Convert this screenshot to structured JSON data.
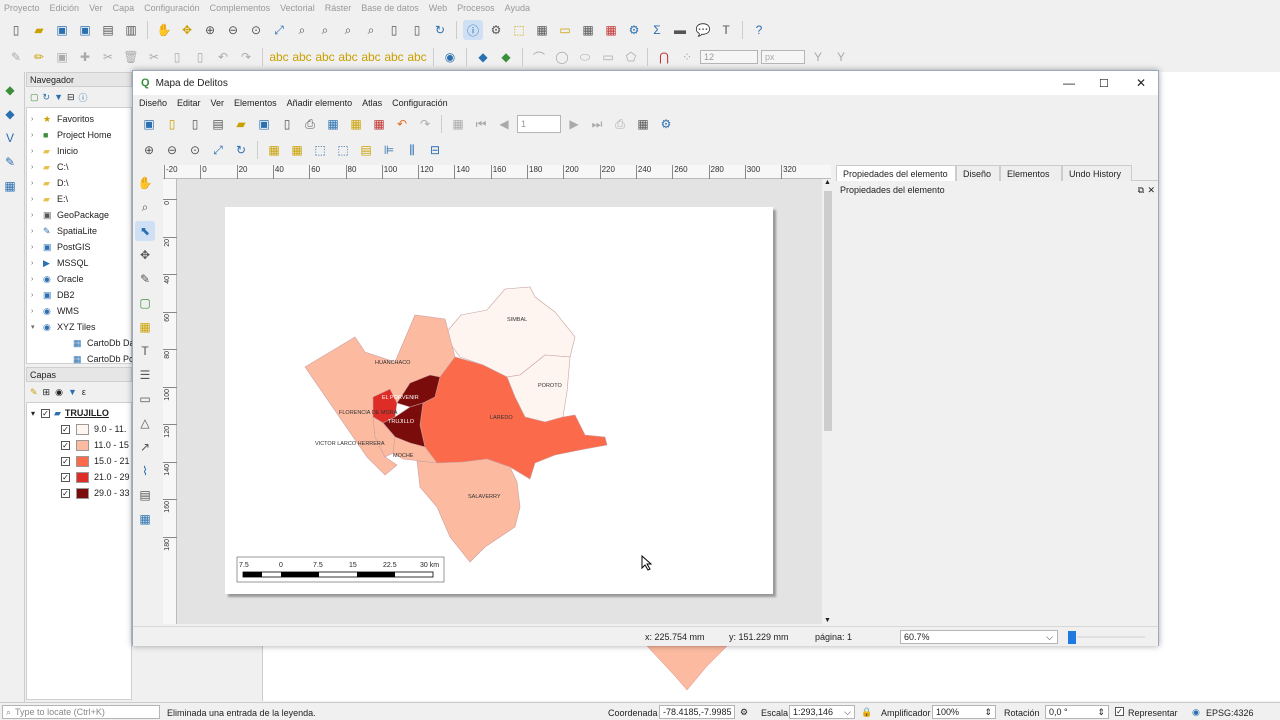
{
  "main_menu": [
    "Proyecto",
    "Edición",
    "Ver",
    "Capa",
    "Configuración",
    "Complementos",
    "Vectorial",
    "Ráster",
    "Base de datos",
    "Web",
    "Procesos",
    "Ayuda"
  ],
  "navigator": {
    "title": "Navegador",
    "items": [
      "Favoritos",
      "Project Home",
      "Inicio",
      "C:\\",
      "D:\\",
      "E:\\",
      "GeoPackage",
      "SpatiaLite",
      "PostGIS",
      "MSSQL",
      "Oracle",
      "DB2",
      "WMS",
      "XYZ Tiles",
      "CartoDb Dark",
      "CartoDb Posit"
    ]
  },
  "layers": {
    "title": "Capas",
    "group": "TRUJILLO",
    "classes": [
      {
        "label": "9.0 - 11.",
        "color": "#fff5f0"
      },
      {
        "label": "11.0 - 15",
        "color": "#fcbba1"
      },
      {
        "label": "15.0 - 21",
        "color": "#fb6a4a"
      },
      {
        "label": "21.0 - 29",
        "color": "#de2d26"
      },
      {
        "label": "29.0 - 33",
        "color": "#7a0c0c"
      }
    ]
  },
  "composer": {
    "title": "Mapa de Delitos",
    "menu": [
      "Diseño",
      "Editar",
      "Ver",
      "Elementos",
      "Añadir elemento",
      "Atlas",
      "Configuración"
    ],
    "page_field": "1",
    "tabs": [
      "Propiedades del elemento",
      "Diseño",
      "Elementos",
      "Undo History"
    ],
    "panel_title": "Propiedades del elemento",
    "ruler_h": [
      "-20",
      "0",
      "20",
      "40",
      "60",
      "80",
      "100",
      "120",
      "140",
      "160",
      "180",
      "200",
      "220",
      "240",
      "260",
      "280",
      "300",
      "320"
    ],
    "ruler_v": [
      "0",
      "20",
      "40",
      "60",
      "80",
      "100",
      "120",
      "140",
      "160",
      "180"
    ],
    "status": {
      "x": "x: 225.754 mm",
      "y": "y: 151.229 mm",
      "page": "página: 1",
      "zoom": "60.7%"
    },
    "map_labels": [
      "SIMBAL",
      "HUANCHACO",
      "POROTO",
      "EL PORVENIR",
      "FLORENCIA DE MORA",
      "LAREDO",
      "TRUJILLO",
      "VICTOR LARCO HERRERA",
      "MOCHE",
      "SALAVERRY"
    ],
    "scalebar": [
      "7.5",
      "0",
      "7.5",
      "15",
      "22.5",
      "30 km"
    ]
  },
  "statusbar": {
    "locate_placeholder": "Type to locate (Ctrl+K)",
    "message": "Eliminada una entrada de la leyenda.",
    "coord_label": "Coordenada",
    "coord_value": "-78.4185,-7.9985",
    "scale_label": "Escala",
    "scale_value": "1:293,146",
    "magnifier_label": "Amplificador",
    "magnifier_value": "100%",
    "rotation_label": "Rotación",
    "rotation_value": "0,0 °",
    "render_label": "Representar",
    "crs": "EPSG:4326"
  },
  "toolbar2": {
    "font_size_value": "12",
    "unit_value": "px"
  }
}
